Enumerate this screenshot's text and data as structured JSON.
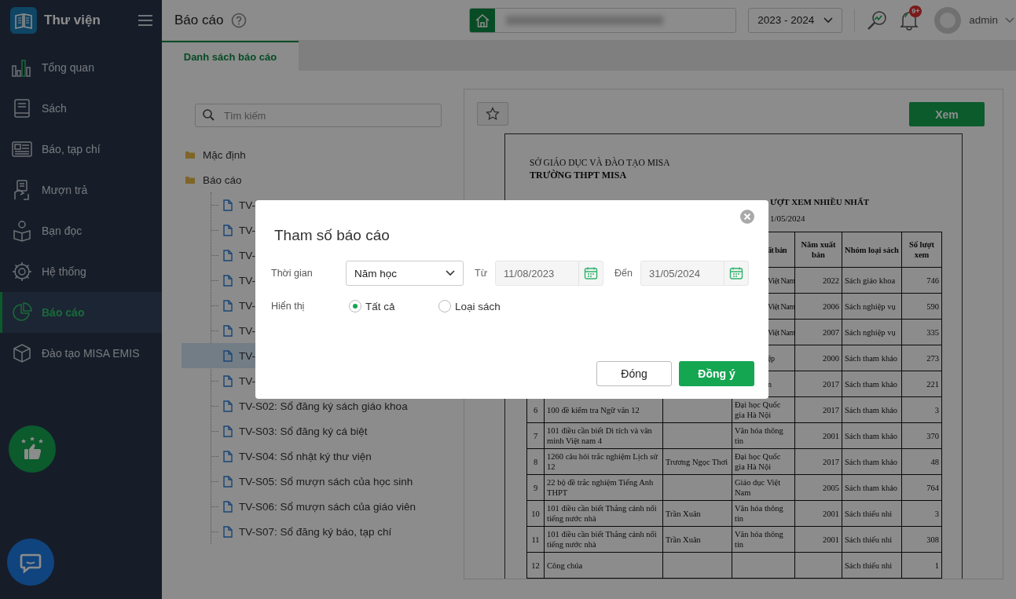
{
  "app": {
    "title": "Thư viện"
  },
  "sidebar": {
    "items": [
      {
        "label": "Tổng quan",
        "kind": "chart",
        "selected": false
      },
      {
        "label": "Sách",
        "kind": "book",
        "selected": false
      },
      {
        "label": "Báo, tạp chí",
        "kind": "newspaper",
        "selected": false
      },
      {
        "label": "Mượn trả",
        "kind": "hand",
        "selected": false
      },
      {
        "label": "Bạn đọc",
        "kind": "reader",
        "selected": false
      },
      {
        "label": "Hệ thống",
        "kind": "gear",
        "selected": false
      },
      {
        "label": "Báo cáo",
        "kind": "pie",
        "selected": true
      },
      {
        "label": "Đào tạo MISA EMIS",
        "kind": "cube",
        "selected": false
      }
    ]
  },
  "header": {
    "title": "Báo cáo",
    "school_year": "2023 - 2024",
    "notifications": "9+",
    "user": "admin"
  },
  "tabs": [
    {
      "label": "Danh sách báo cáo",
      "selected": true
    }
  ],
  "search": {
    "placeholder": "Tìm kiếm"
  },
  "tree": [
    {
      "label": "Mặc định"
    },
    {
      "label": "Báo cáo",
      "children": [
        {
          "label": "TV-",
          "selected": false
        },
        {
          "label": "TV-",
          "selected": false
        },
        {
          "label": "TV-",
          "selected": false
        },
        {
          "label": "TV-",
          "selected": false
        },
        {
          "label": "TV-",
          "selected": false
        },
        {
          "label": "TV-",
          "selected": false
        },
        {
          "label": "TV-",
          "selected": true
        },
        {
          "label": "TV-",
          "selected": false
        },
        {
          "label": "TV-S02: Sổ đăng ký sách giáo khoa",
          "selected": false
        },
        {
          "label": "TV-S03: Sổ đăng ký cá biệt",
          "selected": false
        },
        {
          "label": "TV-S04: Sổ nhật ký thư viện",
          "selected": false
        },
        {
          "label": "TV-S05: Sổ mượn sách của học sinh",
          "selected": false
        },
        {
          "label": "TV-S06: Sổ mượn sách của giáo viên",
          "selected": false
        },
        {
          "label": "TV-S07: Sổ đăng ký báo, tạp chí",
          "selected": false
        }
      ]
    }
  ],
  "report_toolbar": {
    "view_button": "Xem"
  },
  "report_preview": {
    "department": "SỞ GIÁO DỤC VÀ ĐÀO TẠO MISA",
    "school": "TRƯỜNG THPT MISA",
    "title": "ƯỢT XEM NHIỀU NHẤT",
    "date": "1/05/2024",
    "columns": {
      "publisher": "ất bản",
      "year": "Năm xuất bản",
      "group": "Nhóm loại sách",
      "views": "Số lượt xem"
    },
    "rows": [
      {
        "publisher": "Việt Nam",
        "year": "2022",
        "group": "Sách giáo khoa",
        "views": "746"
      },
      {
        "publisher": "Việt Nam",
        "year": "2006",
        "group": "Sách nghiệp vụ",
        "views": "590"
      },
      {
        "publisher": "Việt Nam",
        "year": "2007",
        "group": "Sách nghiệp vụ",
        "views": "335"
      },
      {
        "publisher": "ệp",
        "year": "2000",
        "group": "Sách tham khảo",
        "views": "273"
      },
      {
        "publisher": "n",
        "year": "2017",
        "group": "Sách tham khảo",
        "views": "221"
      },
      {
        "no": "6",
        "title": "100 đề kiểm tra Ngữ văn 12",
        "publisher": "Đại học Quốc gia Hà Nội",
        "year": "2017",
        "group": "Sách tham khảo",
        "views": "3"
      },
      {
        "no": "7",
        "title": "101 điều cần biết Di tích và văn minh Việt nam 4",
        "publisher": "Văn hóa thông tin",
        "year": "2001",
        "group": "Sách tham khảo",
        "views": "370"
      },
      {
        "no": "8",
        "title": "1260 câu hỏi trắc nghiệm Lịch sử 12",
        "author": "Trương Ngọc Thơi",
        "publisher": "Đại học Quốc gia Hà Nội",
        "year": "2017",
        "group": "Sách tham khảo",
        "views": "48"
      },
      {
        "no": "9",
        "title": "22 bộ đề trắc nghiệm Tiếng Anh THPT",
        "publisher": "Giáo dục Việt Nam",
        "year": "2005",
        "group": "Sách tham khảo",
        "views": "764"
      },
      {
        "no": "10",
        "title": "101 điều cần biết Thắng cảnh nổi tiếng nước nhà",
        "author": "Trần Xuân",
        "publisher": "Văn hóa thông tin",
        "year": "2001",
        "group": "Sách thiếu nhi",
        "views": "3"
      },
      {
        "no": "11",
        "title": "101 điều cần biết Thắng cảnh nổi tiếng nước nhà",
        "author": "Trần Xuân",
        "publisher": "Văn hóa thông tin",
        "year": "2001",
        "group": "Sách thiếu nhi",
        "views": "308"
      },
      {
        "no": "12",
        "title": "Công chúa",
        "group": "Sách thiếu nhi",
        "views": "1"
      }
    ]
  },
  "dialog": {
    "title": "Tham số báo cáo",
    "period": {
      "label": "Thời gian",
      "value": "Năm học"
    },
    "from": {
      "label": "Từ",
      "value": "11/08/2023",
      "disabled": true
    },
    "to": {
      "label": "Đến",
      "value": "31/05/2024",
      "disabled": true
    },
    "display": {
      "label": "Hiển thị",
      "options": [
        {
          "label": "Tất cả",
          "selected": true
        },
        {
          "label": "Loại sách",
          "selected": false
        }
      ]
    },
    "buttons": {
      "close": "Đóng",
      "confirm": "Đồng ý"
    }
  }
}
